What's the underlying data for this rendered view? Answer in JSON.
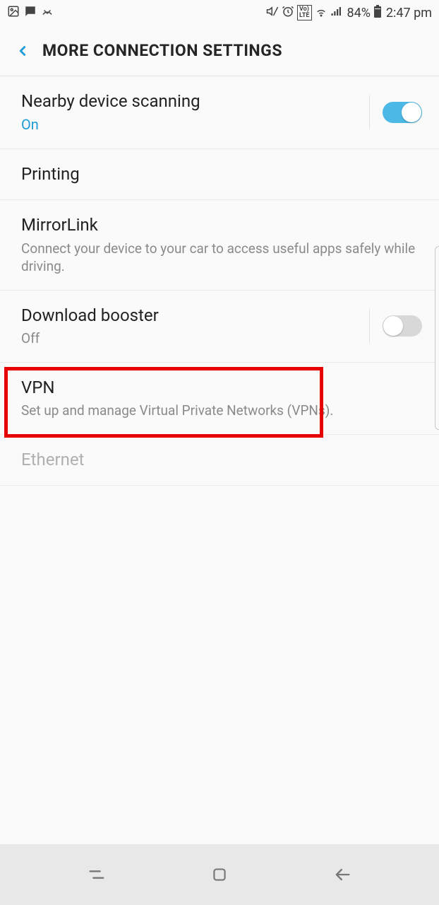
{
  "status_bar": {
    "battery_pct": "84%",
    "time": "2:47 pm"
  },
  "header": {
    "title": "MORE CONNECTION SETTINGS"
  },
  "settings": {
    "nearby": {
      "title": "Nearby device scanning",
      "sub": "On",
      "toggle": true
    },
    "printing": {
      "title": "Printing"
    },
    "mirrorlink": {
      "title": "MirrorLink",
      "sub": "Connect your device to your car to access useful apps safely while driving."
    },
    "download_booster": {
      "title": "Download booster",
      "sub": "Off",
      "toggle": false
    },
    "vpn": {
      "title": "VPN",
      "sub": "Set up and manage Virtual Private Networks (VPNs)."
    },
    "ethernet": {
      "title": "Ethernet"
    }
  },
  "colors": {
    "accent": "#1e9bd6",
    "toggle_on": "#4cb8e6",
    "highlight": "#e80000"
  }
}
